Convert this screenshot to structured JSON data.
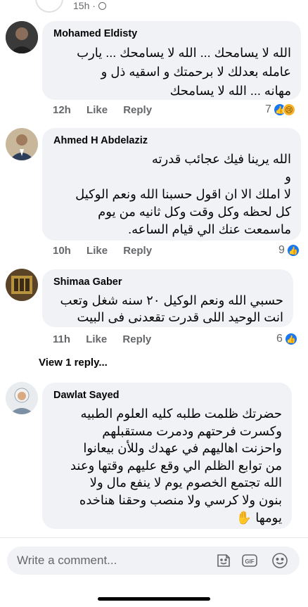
{
  "header": {
    "time": "15h · "
  },
  "comments": [
    {
      "author": "Mohamed Eldisty",
      "text": "الله لا يسامحك ... الله لا يسامحك ... يارب\nعامله بعدلك لا برحمتك و اسقيه ذل و\nمهانه ... الله لا يسامحك",
      "time": "12h",
      "like": "Like",
      "reply": "Reply",
      "reactions": "7",
      "reaction_icons": [
        "like-icon",
        "sad-icon"
      ]
    },
    {
      "author": "Ahmed H Abdelaziz",
      "text": "الله يرينا فيك عجائب قدرته\nو\nلا املك الا ان اقول حسبنا الله ونعم الوكيل\nكل لحظه وكل وقت وكل ثانيه من يوم\nماسمعت عنك  الي قيام الساعه.",
      "time": "10h",
      "like": "Like",
      "reply": "Reply",
      "reactions": "9",
      "reaction_icons": [
        "like-icon"
      ]
    },
    {
      "author": "Shimaa Gaber",
      "text": "حسبي الله ونعم الوكيل ٢٠ سنه شغل وتعب\nانت الوحيد اللى قدرت تقعدنى فى البيت",
      "time": "11h",
      "like": "Like",
      "reply": "Reply",
      "reactions": "6",
      "reaction_icons": [
        "like-icon"
      ]
    },
    {
      "author": "Dawlat Sayed",
      "text": "حضرتك ظلمت طلبه كليه العلوم الطبيه\nوكسرت فرحتهم ودمرت مستقبلهم\nواحزنت اهاليهم في عهدك وللأن بيعانوا\nمن توابع الظلم الي وقع عليهم وقتها وعند\nالله تجتمع الخصوم يوم لا ينفع مال ولا\nبنون ولا كرسي ولا منصب وحقنا هناخده\nيومها ✋"
    }
  ],
  "view_replies": "View 1 reply...",
  "composer": {
    "placeholder": "Write a comment...",
    "icons": [
      "sticker-icon",
      "gif-icon",
      "emoji-icon"
    ],
    "gif_label": "GIF"
  },
  "colors": {
    "bubble": "#f0f2f5",
    "muted": "#65676b",
    "like_blue": "#1877f2",
    "sad_yellow": "#f7b125"
  }
}
